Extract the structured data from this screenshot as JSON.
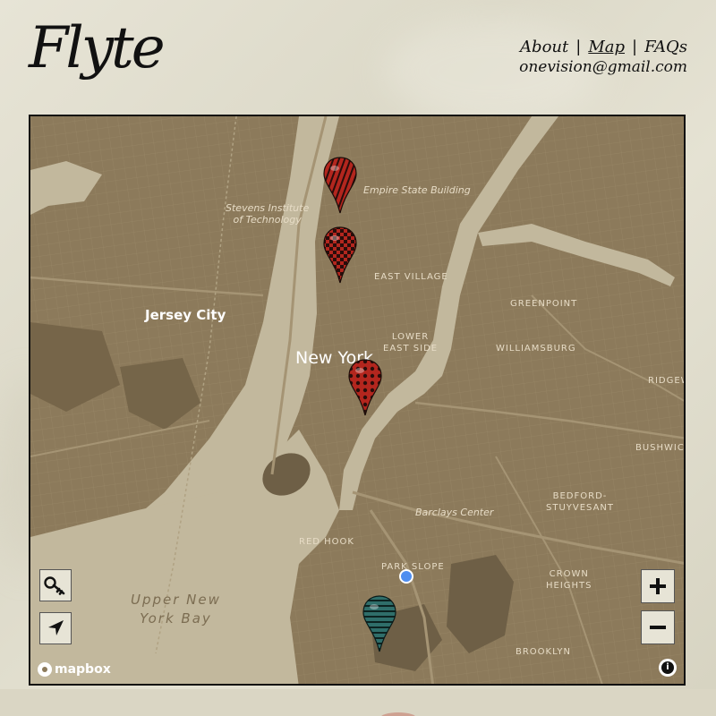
{
  "brand": {
    "logo_text": "Flyte"
  },
  "nav": {
    "links": [
      {
        "label": "About",
        "active": false
      },
      {
        "label": "Map",
        "active": true
      },
      {
        "label": "FAQs",
        "active": false
      }
    ],
    "separator": "|",
    "email": "onevision@gmail.com"
  },
  "map": {
    "labels": {
      "empire_state": "Empire State Building",
      "stevens": "Stevens Institute\nof Technology",
      "east_village": "EAST VILLAGE",
      "greenpoint": "GREENPOINT",
      "jersey_city": "Jersey City",
      "lower_east_side": "LOWER\nEAST SIDE",
      "williamsburg": "WILLIAMSBURG",
      "new_york": "New York",
      "ridgewood": "RIDGEW",
      "bushwick": "BUSHWICK",
      "bedford": "BEDFORD-\nSTUYVESANT",
      "barclays": "Barclays Center",
      "red_hook": "RED HOOK",
      "park_slope": "PARK SLOPE",
      "crown_heights": "CROWN\nHEIGHTS",
      "upper_bay": "Upper New\nYork Bay",
      "brooklyn": "BROOKLYN"
    },
    "markers": [
      {
        "name": "marker-midtown",
        "pattern": "red-stripes",
        "color": "#b3261e"
      },
      {
        "name": "marker-union-square",
        "pattern": "red-checker",
        "color": "#b3261e"
      },
      {
        "name": "marker-lower-manhattan",
        "pattern": "red-dots",
        "color": "#b3261e"
      },
      {
        "name": "marker-park-slope",
        "pattern": "teal-stripes",
        "color": "#2f6e6a"
      }
    ],
    "controls": {
      "key_icon": "key-icon",
      "locate_icon": "navigation-arrow-icon",
      "zoom_in_icon": "plus-icon",
      "zoom_out_icon": "minus-icon"
    },
    "attribution": {
      "logo": "mapbox",
      "info_icon": "info-icon",
      "info_glyph": "i"
    },
    "colors": {
      "land": "#8c7a5b",
      "water": "#c2b89d",
      "park": "#6e5f46",
      "road": "#a59474"
    }
  }
}
